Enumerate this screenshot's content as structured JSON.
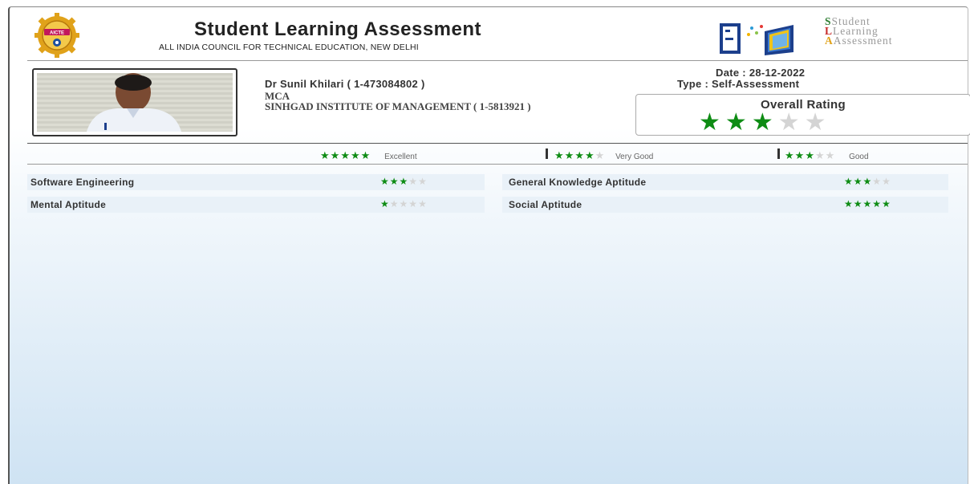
{
  "header": {
    "title": "Student Learning Assessment",
    "subtitle": "ALL INDIA COUNCIL FOR TECHNICAL EDUCATION, NEW DELHI",
    "logo_left_text": "AICTE",
    "logo_right_text": [
      "Student",
      "Learning",
      "Assessment"
    ],
    "logo_right_initials": [
      "S",
      "L",
      "A"
    ]
  },
  "profile": {
    "name": "Dr Sunil Khilari ( 1-473084802 )",
    "degree": "MCA",
    "institute": "SINHGAD INSTITUTE OF MANAGEMENT ( 1-5813921 )",
    "date": "Date : 28-12-2022",
    "type": "Type : Self-Assessment"
  },
  "overall": {
    "label": "Overall Rating",
    "rating": 3,
    "max": 5
  },
  "legend": [
    {
      "label": "Excellent",
      "rating": 5
    },
    {
      "label": "Very Good",
      "rating": 4
    },
    {
      "label": "Good",
      "rating": 3
    }
  ],
  "skills": [
    {
      "name": "Software Engineering",
      "rating": 3
    },
    {
      "name": "General Knowledge Aptitude",
      "rating": 3
    },
    {
      "name": "Mental Aptitude",
      "rating": 1
    },
    {
      "name": "Social Aptitude",
      "rating": 5
    }
  ],
  "colors": {
    "star_on": "#0e8c14",
    "star_off": "#d4d4d4",
    "row_bg": "#e9f1f8",
    "panel_bottom": "#cfe3f3"
  }
}
